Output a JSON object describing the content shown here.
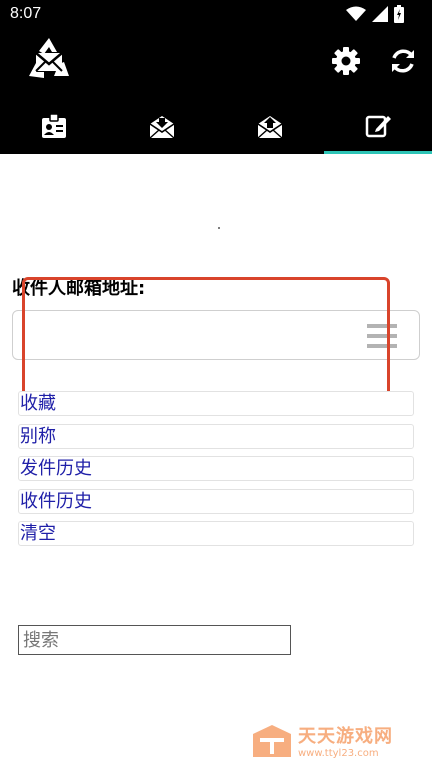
{
  "status_bar": {
    "time": "8:07",
    "icons": [
      "wifi-icon",
      "cell-signal-icon",
      "battery-icon"
    ]
  },
  "app_bar": {
    "logo": "recycle-mail-logo",
    "actions": [
      "gear-icon",
      "refresh-icon"
    ]
  },
  "tabs": [
    {
      "icon": "contact-card-icon",
      "active": false
    },
    {
      "icon": "inbox-receive-icon",
      "active": false
    },
    {
      "icon": "outbox-send-icon",
      "active": false
    },
    {
      "icon": "compose-edit-icon",
      "active": true
    }
  ],
  "colors": {
    "tab_indicator": "#2ec4b6",
    "link_text": "#1f1fa8",
    "highlight_border": "#d9442b"
  },
  "form": {
    "recipient_label": "收件人邮箱地址:",
    "recipient_value": "",
    "options": [
      "收藏",
      "别称",
      "发件历史",
      "收件历史",
      "清空"
    ]
  },
  "search": {
    "placeholder": "搜索"
  },
  "watermark": {
    "title": "天天游戏网",
    "url": "www.ttyl23.com"
  }
}
